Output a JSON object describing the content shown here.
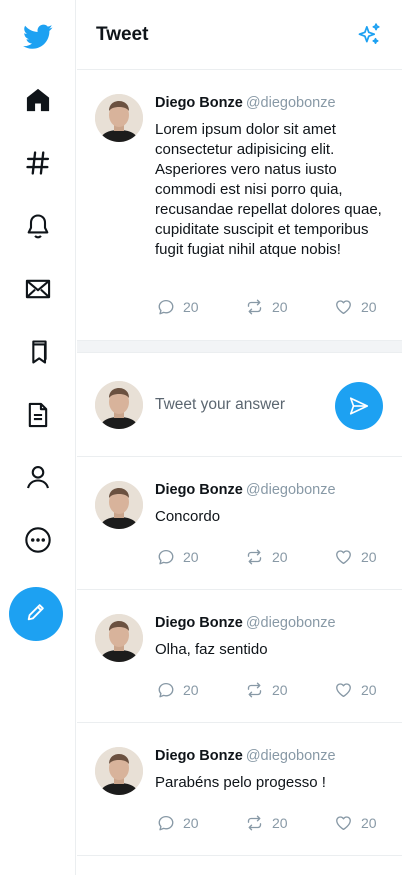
{
  "header": {
    "title": "Tweet"
  },
  "sidebar": {
    "items": [
      "twitter-logo",
      "home-icon",
      "hashtag-icon",
      "bell-icon",
      "mail-icon",
      "bookmark-icon",
      "list-icon",
      "profile-icon",
      "more-icon"
    ],
    "compose": "pencil-icon"
  },
  "main_tweet": {
    "name": "Diego Bonze",
    "handle": "@diegobonze",
    "text": "Lorem ipsum dolor sit amet consectetur adipisicing elit. Asperiores vero natus iusto commodi est nisi porro quia, recusandae repellat dolores quae, cupiditate suscipit et temporibus fugit fugiat nihil atque nobis!",
    "replies": "20",
    "retweets": "20",
    "likes": "20"
  },
  "reply_box": {
    "placeholder": "Tweet your answer"
  },
  "replies": [
    {
      "name": "Diego Bonze",
      "handle": "@diegobonze",
      "text": "Concordo",
      "replies": "20",
      "retweets": "20",
      "likes": "20"
    },
    {
      "name": "Diego Bonze",
      "handle": "@diegobonze",
      "text": "Olha, faz sentido",
      "replies": "20",
      "retweets": "20",
      "likes": "20"
    },
    {
      "name": "Diego Bonze",
      "handle": "@diegobonze",
      "text": "Parabéns pelo progesso !",
      "replies": "20",
      "retweets": "20",
      "likes": "20"
    }
  ],
  "colors": {
    "accent": "#1da1f2",
    "muted": "#8899a6",
    "border": "#ebeef0"
  }
}
